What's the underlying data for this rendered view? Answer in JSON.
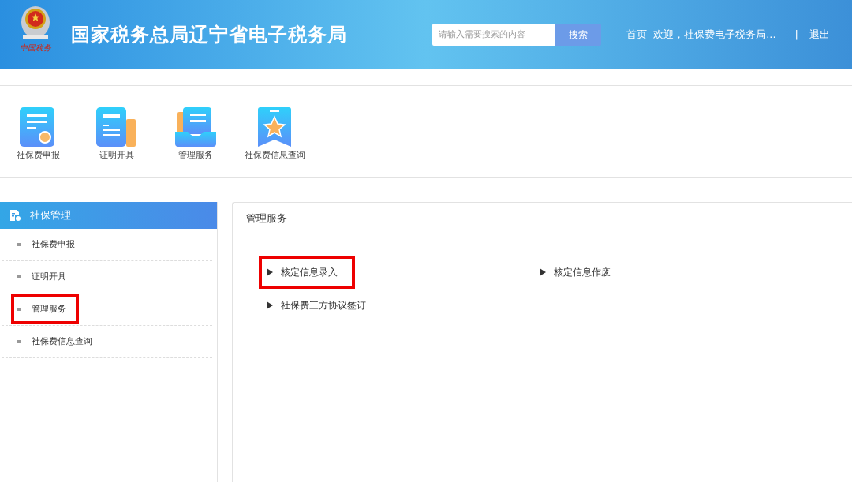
{
  "header": {
    "logo_text": "中国税务",
    "title": "国家税务总局辽宁省电子税务局",
    "search": {
      "placeholder": "请输入需要搜索的内容",
      "button": "搜索"
    },
    "nav": [
      {
        "label": "首页"
      },
      {
        "label": "欢迎，社保费电子税务局..."
      }
    ],
    "separator": "|",
    "logout": "退出"
  },
  "shortcuts": [
    {
      "kind": "declare",
      "label": "社保费申报"
    },
    {
      "kind": "certificate",
      "label": "证明开具"
    },
    {
      "kind": "service",
      "label": "管理服务"
    },
    {
      "kind": "query",
      "label": "社保费信息查询"
    }
  ],
  "sidebar": {
    "title": "社保管理",
    "items": [
      {
        "label": "社保费申报",
        "highlighted": false
      },
      {
        "label": "证明开具",
        "highlighted": false
      },
      {
        "label": "管理服务",
        "highlighted": true
      },
      {
        "label": "社保费信息查询",
        "highlighted": false
      }
    ]
  },
  "panel": {
    "title": "管理服务",
    "links": [
      {
        "label": "核定信息录入",
        "highlighted": true
      },
      {
        "label": "核定信息作废",
        "highlighted": false
      },
      {
        "label": "社保费三方协议签订",
        "highlighted": false
      }
    ]
  }
}
